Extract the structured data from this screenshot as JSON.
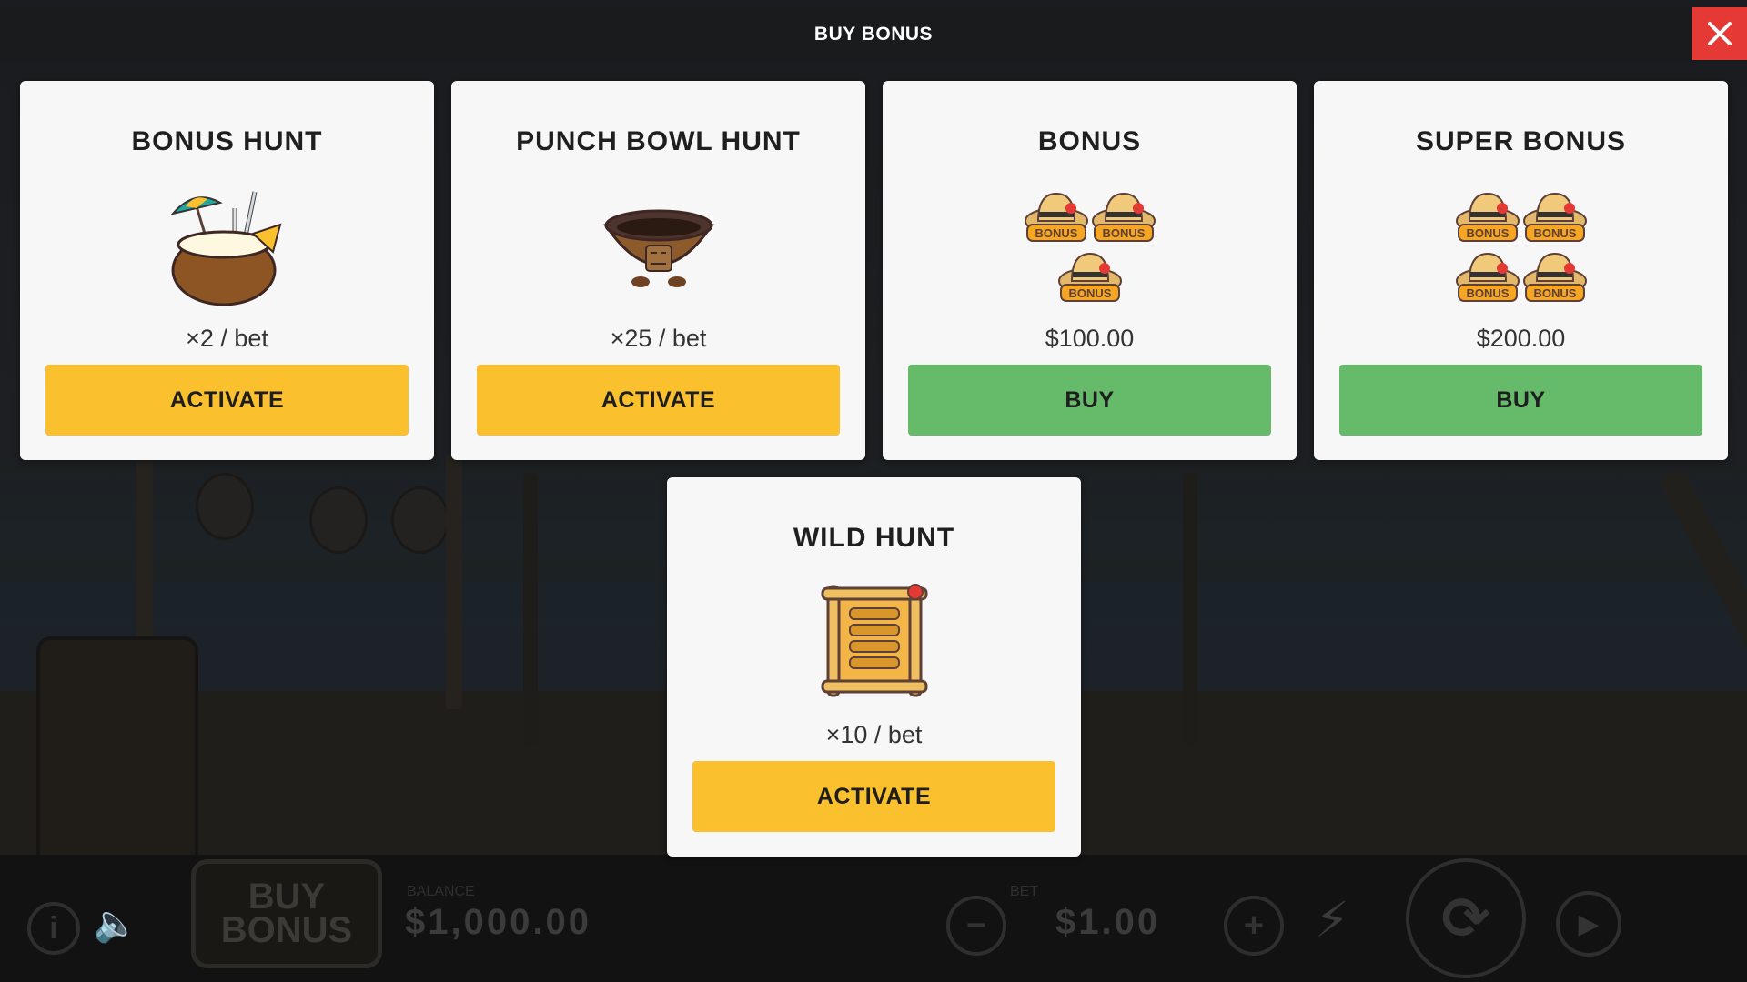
{
  "overlay": {
    "title": "BUY BONUS",
    "close_icon": "close-icon",
    "accent_close": "#e53935"
  },
  "cards": [
    {
      "title": "BONUS HUNT",
      "icon": "coconut-drink-icon",
      "price": "×2 / bet",
      "button": "ACTIVATE",
      "button_color": "#fbc02d"
    },
    {
      "title": "PUNCH BOWL HUNT",
      "icon": "tiki-punch-bowl-icon",
      "price": "×25 / bet",
      "button": "ACTIVATE",
      "button_color": "#fbc02d"
    },
    {
      "title": "BONUS",
      "icon": "three-bonus-hats-icon",
      "hat_label": "BONUS",
      "price": "$100.00",
      "button": "BUY",
      "button_color": "#66bb6a"
    },
    {
      "title": "SUPER BONUS",
      "icon": "four-bonus-hats-icon",
      "hat_label": "BONUS",
      "price": "$200.00",
      "button": "BUY",
      "button_color": "#66bb6a"
    },
    {
      "title": "WILD HUNT",
      "icon": "bamboo-frame-icon",
      "price": "×10 / bet",
      "button": "ACTIVATE",
      "button_color": "#fbc02d"
    }
  ],
  "hud": {
    "buy_bonus_label": "BUY BONUS",
    "balance_label": "BALANCE",
    "balance_value": "$1,000.00",
    "bet_label": "BET",
    "bet_value": "$1.00",
    "info_icon": "info-icon",
    "sound_icon": "speaker-icon",
    "minus_icon": "minus-icon",
    "plus_icon": "plus-icon",
    "turbo_icon": "lightning-icon",
    "spin_icon": "spin-icon",
    "autoplay_icon": "autoplay-icon"
  }
}
